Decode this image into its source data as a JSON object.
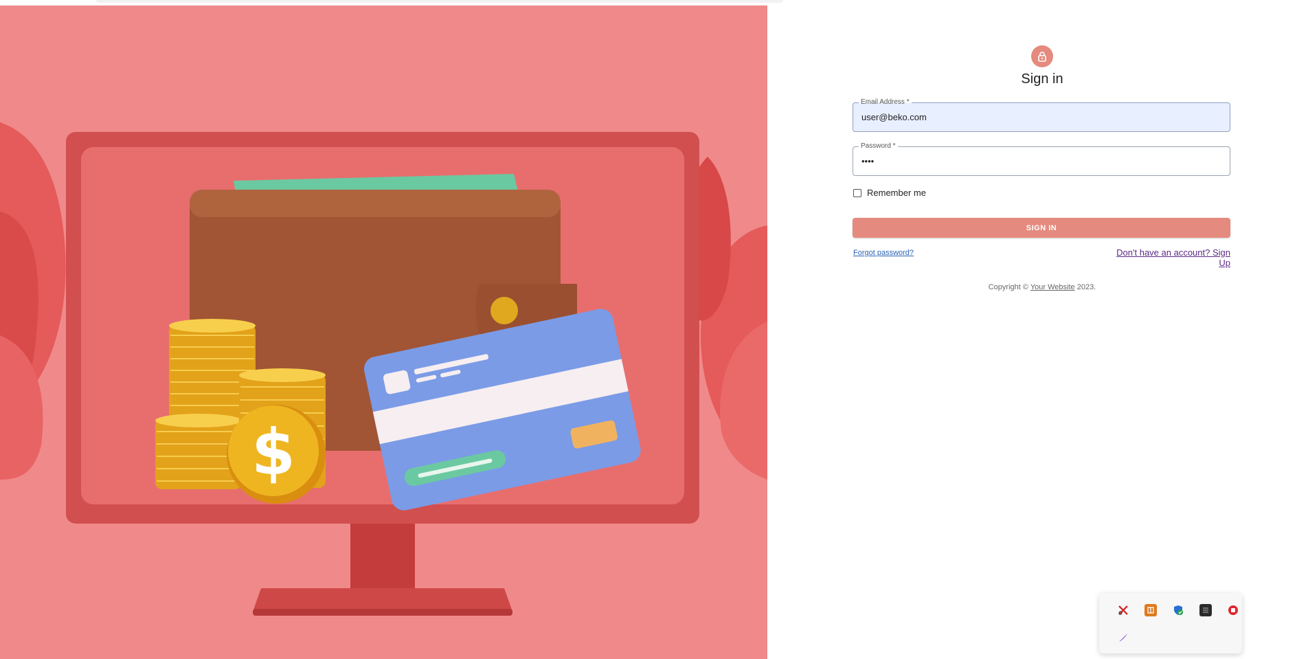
{
  "login": {
    "title": "Sign in",
    "email": {
      "label": "Email Address *",
      "value": "user@beko.com"
    },
    "password": {
      "label": "Password *",
      "value": "••••"
    },
    "remember_label": "Remember me",
    "submit_label": "SIGN IN",
    "forgot_label": "Forgot password?",
    "signup_label": "Don't have an account? Sign Up",
    "copyright_prefix": "Copyright ©",
    "copyright_link": "Your Website",
    "copyright_suffix": "2023."
  },
  "hero": {
    "illustration": "wallet-card-coins-on-monitor",
    "coin_symbol": "$"
  },
  "tray": {
    "icons": [
      "snip-icon",
      "archive-app-icon",
      "security-shield-icon",
      "terminal-app-icon",
      "red-circle-app-icon",
      "pen-feather-icon"
    ]
  },
  "colors": {
    "hero_bg": "#f08a8a",
    "accent": "#e58a7e",
    "email_fill": "#e8efff"
  }
}
